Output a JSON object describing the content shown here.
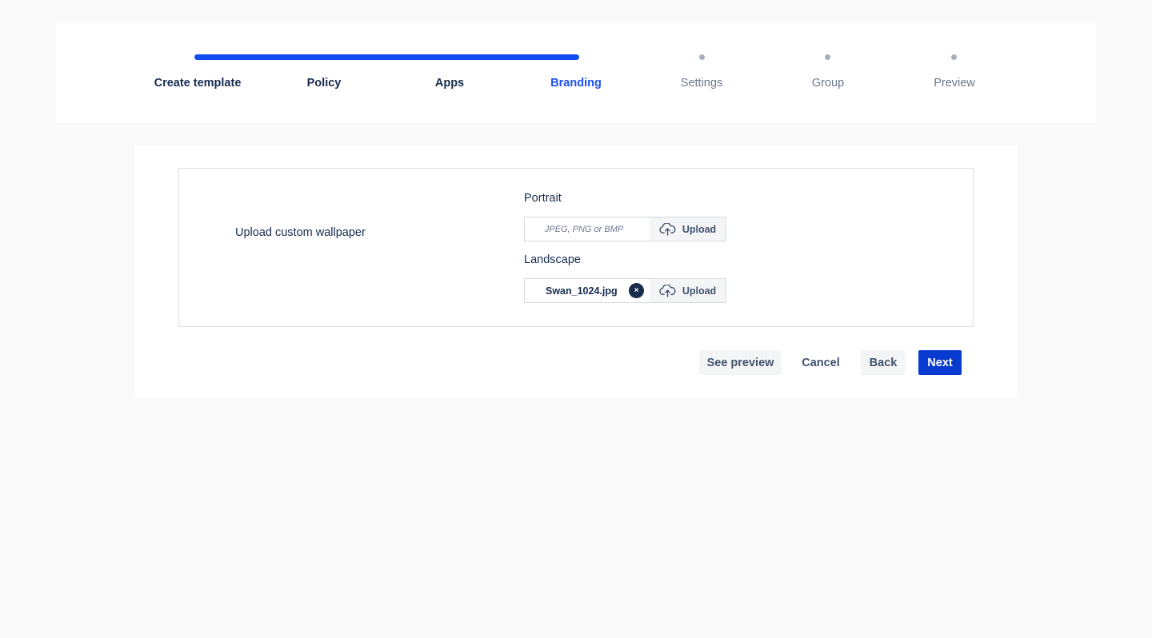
{
  "stepper": {
    "steps": [
      {
        "label": "Create template",
        "state": "done"
      },
      {
        "label": "Policy",
        "state": "done"
      },
      {
        "label": "Apps",
        "state": "done"
      },
      {
        "label": "Branding",
        "state": "current"
      },
      {
        "label": "Settings",
        "state": "todo"
      },
      {
        "label": "Group",
        "state": "todo"
      },
      {
        "label": "Preview",
        "state": "todo"
      }
    ],
    "progress_fraction": 0.5
  },
  "wallpaper": {
    "section_label": "Upload custom wallpaper",
    "portrait": {
      "label": "Portrait",
      "placeholder": "JPEG, PNG or BMP",
      "upload_label": "Upload"
    },
    "landscape": {
      "label": "Landscape",
      "file_name": "Swan_1024.jpg",
      "clear_symbol": "×",
      "upload_label": "Upload"
    }
  },
  "actions": {
    "see_preview": "See preview",
    "cancel": "Cancel",
    "back": "Back",
    "next": "Next"
  },
  "colors": {
    "accent": "#0f4af2",
    "primary_button": "#0a3bd1",
    "text": "#172b4d",
    "muted": "#6b778c"
  },
  "icons": {
    "upload": "cloud-upload-icon",
    "clear": "close-circle-icon",
    "pending_step": "dot-icon"
  }
}
